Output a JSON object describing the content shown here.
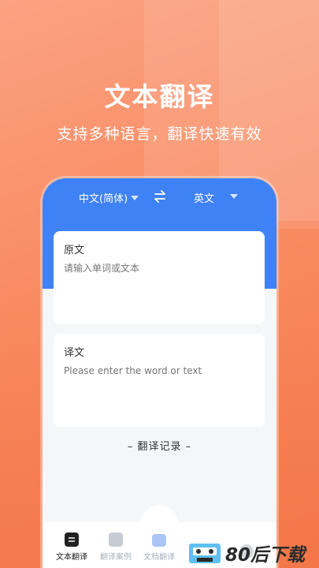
{
  "hero": {
    "title": "文本翻译",
    "subtitle": "支持多种语言，翻译快速有效"
  },
  "lang_bar": {
    "source_language": "中文(简体)",
    "target_language": "英文"
  },
  "source_card": {
    "label": "原文",
    "placeholder": "请输入单词或文本"
  },
  "target_card": {
    "label": "译文",
    "placeholder": "Please enter the word or text"
  },
  "history_link": "– 翻译记录 –",
  "nav": {
    "items": [
      {
        "label": "文本翻译",
        "icon": "text-translate-icon"
      },
      {
        "label": "翻译案例",
        "icon": "folder-icon"
      },
      {
        "label": "文档翻译",
        "icon": "document-folder-icon"
      },
      {
        "label": "",
        "icon": "clock-icon"
      },
      {
        "label": "",
        "icon": "face-icon"
      }
    ]
  },
  "watermark": {
    "text": "80后下载"
  },
  "colors": {
    "accent_blue": "#3f82f6",
    "background_orange": "#f98b62"
  }
}
